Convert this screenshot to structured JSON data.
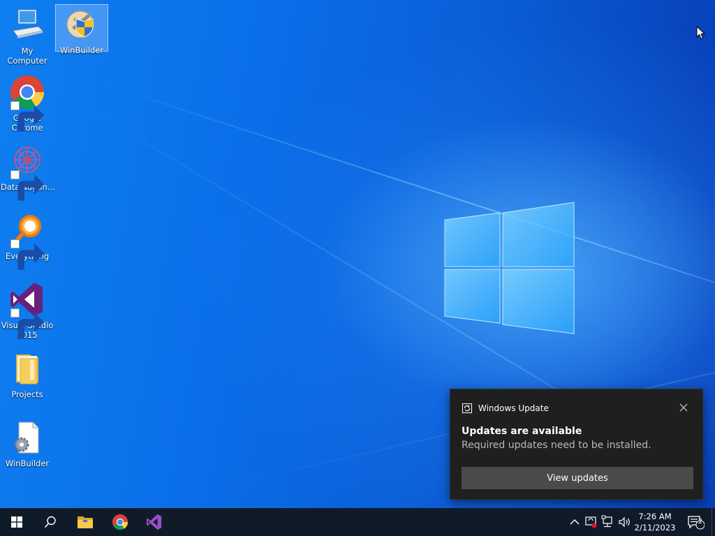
{
  "desktop": {
    "icons": [
      {
        "label": "My Computer",
        "icon": "computer-icon"
      },
      {
        "label": "WinBuilder",
        "icon": "winbuilder-tools-icon",
        "selected": true
      },
      {
        "label": "Google Chrome",
        "icon": "chrome-icon",
        "shortcut": true
      },
      {
        "label": "DataWagon...",
        "icon": "datawagon-icon",
        "shortcut": true
      },
      {
        "label": "Everything",
        "icon": "everything-search-icon",
        "shortcut": true
      },
      {
        "label": "Visual Studio 2015",
        "icon": "visual-studio-icon",
        "shortcut": true
      },
      {
        "label": "Projects",
        "icon": "folder-icon"
      },
      {
        "label": "WinBuilder",
        "icon": "gear-file-icon"
      }
    ]
  },
  "notification": {
    "app": "Windows Update",
    "title": "Updates are available",
    "body": "Required updates need to be installed.",
    "action_label": "View updates"
  },
  "taskbar": {
    "items": [
      "start-icon",
      "search-icon",
      "file-explorer-icon",
      "chrome-icon",
      "visual-studio-icon"
    ],
    "tray": [
      "chevron-up-icon",
      "shield-alert-icon",
      "network-icon",
      "volume-icon"
    ],
    "clock": {
      "time": "7:26 AM",
      "date": "2/11/2023"
    },
    "notification_count": "2"
  },
  "colors": {
    "taskbar": "#101b2a",
    "toast_bg": "#1f1f1f",
    "toast_button": "#4a4a4a",
    "wallpaper": "#0a5fd8"
  }
}
